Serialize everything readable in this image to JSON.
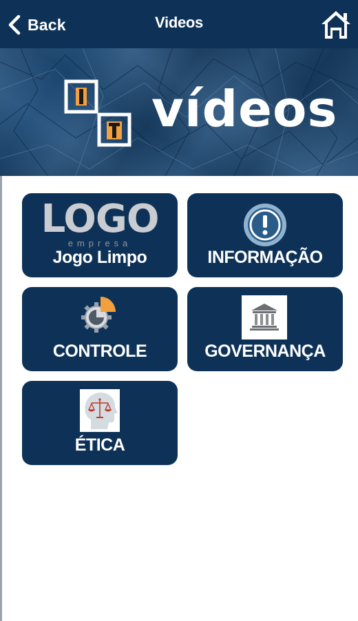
{
  "topbar": {
    "back_label": "Back",
    "title": "Videos"
  },
  "banner": {
    "word": "vídeos",
    "logo_letters": [
      "I",
      "T"
    ]
  },
  "tiles": [
    {
      "label": "Jogo Limpo",
      "logo_text": "LOGO",
      "logo_subtext": "empresa",
      "icon": "company-logo"
    },
    {
      "label": "INFORMAÇÃO",
      "icon": "info-icon"
    },
    {
      "label": "CONTROLE",
      "icon": "gear-pie-icon"
    },
    {
      "label": "GOVERNANÇA",
      "icon": "bank-icon"
    },
    {
      "label": "ÉTICA",
      "icon": "ethics-scale-icon"
    }
  ],
  "colors": {
    "primary": "#0e3257",
    "banner": "#1d4b78",
    "accent_orange": "#f2a03d",
    "background": "#ffffff"
  }
}
